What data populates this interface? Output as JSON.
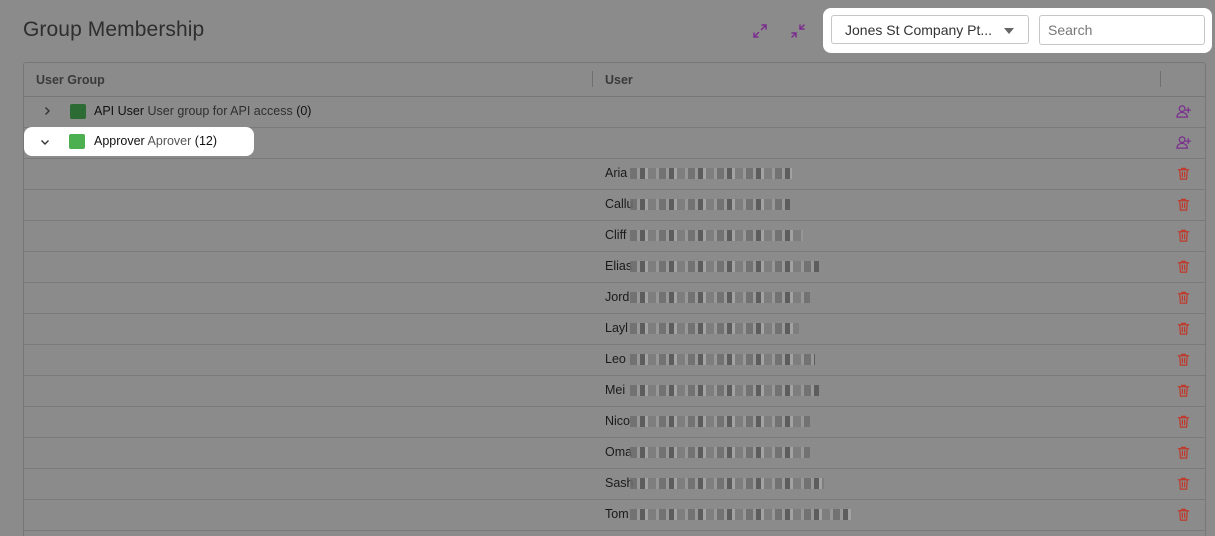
{
  "page": {
    "title": "Group Membership"
  },
  "header_icons": [
    "expand-arrows-icon",
    "collapse-arrows-icon"
  ],
  "filters": {
    "company_selected": "Jones St Company Pt...",
    "search_placeholder": "Search"
  },
  "table": {
    "columns": [
      "User Group",
      "User"
    ],
    "groups": [
      {
        "name": "API User",
        "description": "User group for API access",
        "count": "(0)",
        "expanded": false,
        "color": "#2d6b34"
      },
      {
        "name": "Approver",
        "description": "Aprover",
        "count": "(12)",
        "expanded": true,
        "color": "#4caf50"
      }
    ],
    "members": [
      {
        "name": "Aria"
      },
      {
        "name": "Callu"
      },
      {
        "name": "Cliff"
      },
      {
        "name": "Elias"
      },
      {
        "name": "Jord"
      },
      {
        "name": "Layl"
      },
      {
        "name": "Leo"
      },
      {
        "name": "Mei"
      },
      {
        "name": "Nico"
      },
      {
        "name": "Oma"
      },
      {
        "name": "Sash"
      },
      {
        "name": "Tom"
      }
    ]
  },
  "colors": {
    "accent": "#7b2d8e",
    "delete": "#c0392b",
    "overlay": "#8b8b8b"
  }
}
